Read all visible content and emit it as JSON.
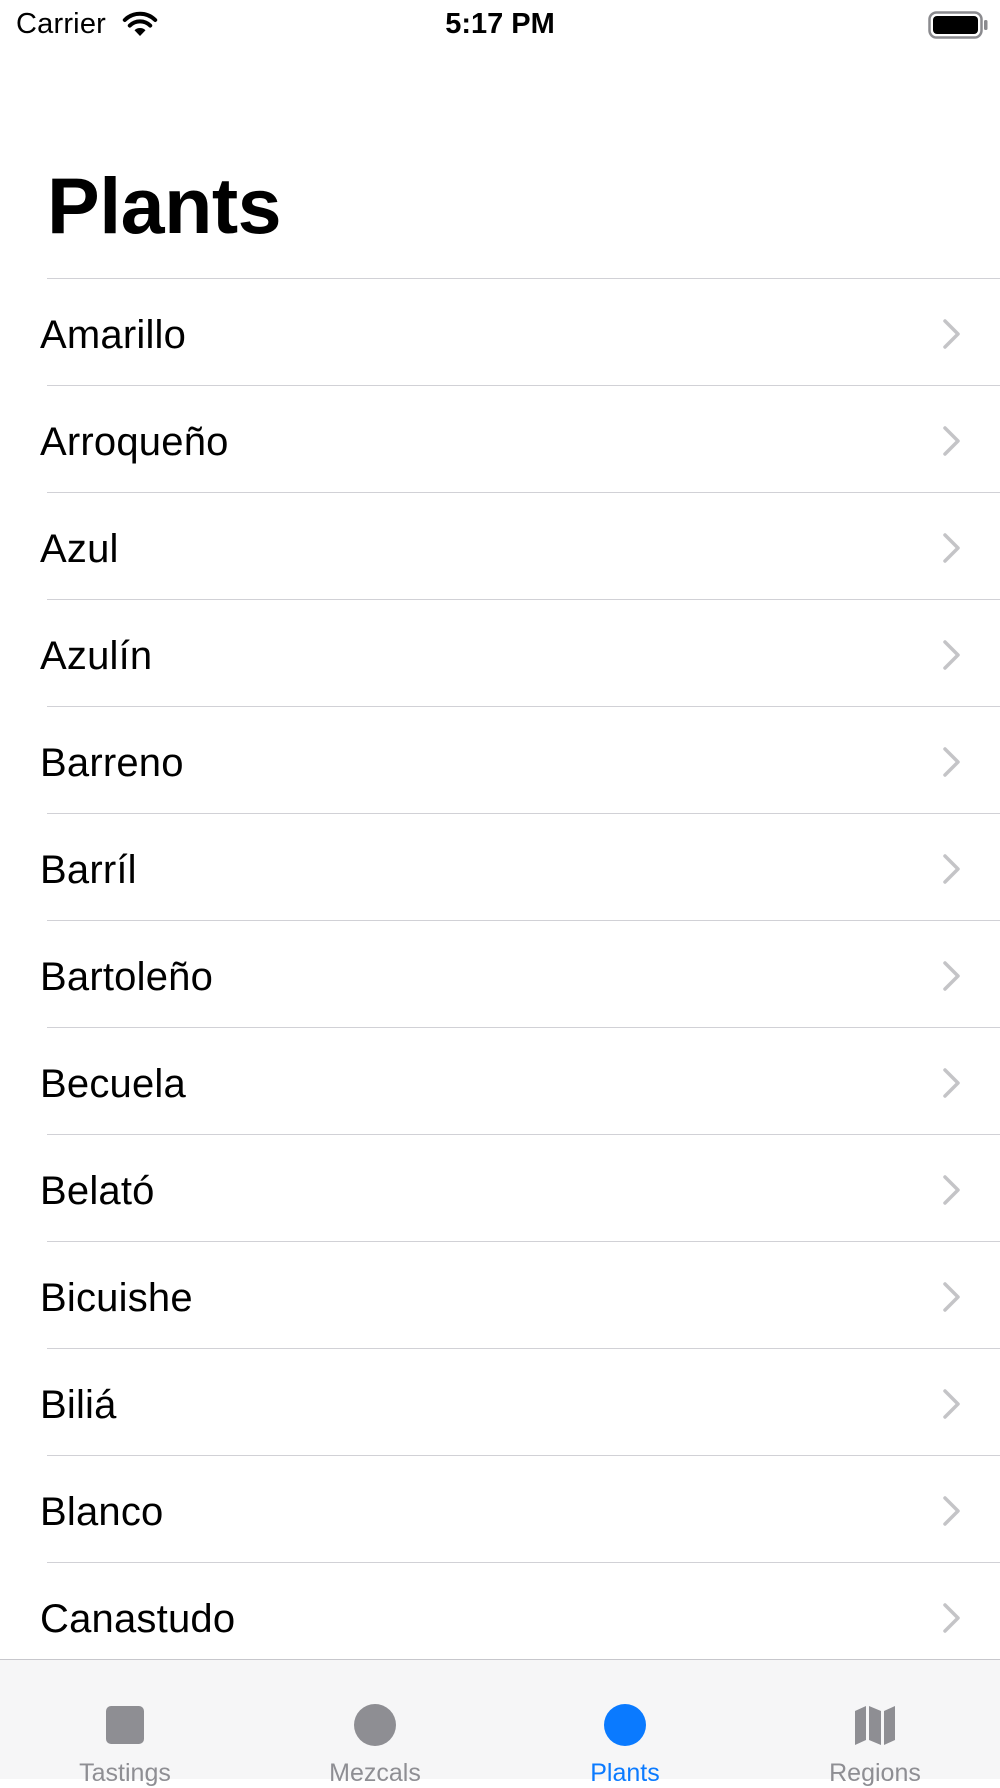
{
  "status_bar": {
    "carrier": "Carrier",
    "time": "5:17 PM"
  },
  "page": {
    "title": "Plants"
  },
  "plants": [
    {
      "name": "Amarillo"
    },
    {
      "name": "Arroqueño"
    },
    {
      "name": "Azul"
    },
    {
      "name": "Azulín"
    },
    {
      "name": "Barreno"
    },
    {
      "name": "Barríl"
    },
    {
      "name": "Bartoleño"
    },
    {
      "name": "Becuela"
    },
    {
      "name": "Belató"
    },
    {
      "name": "Bicuishe"
    },
    {
      "name": "Biliá"
    },
    {
      "name": "Blanco"
    },
    {
      "name": "Canastudo"
    }
  ],
  "tab_bar": {
    "active_tab": "Plants",
    "active_color": "#0a7aff",
    "inactive_color": "#8e8e93",
    "tabs": [
      {
        "label": "Tastings",
        "icon": "square-icon"
      },
      {
        "label": "Mezcals",
        "icon": "circle-icon"
      },
      {
        "label": "Plants",
        "icon": "circle-icon"
      },
      {
        "label": "Regions",
        "icon": "map-icon"
      }
    ]
  }
}
